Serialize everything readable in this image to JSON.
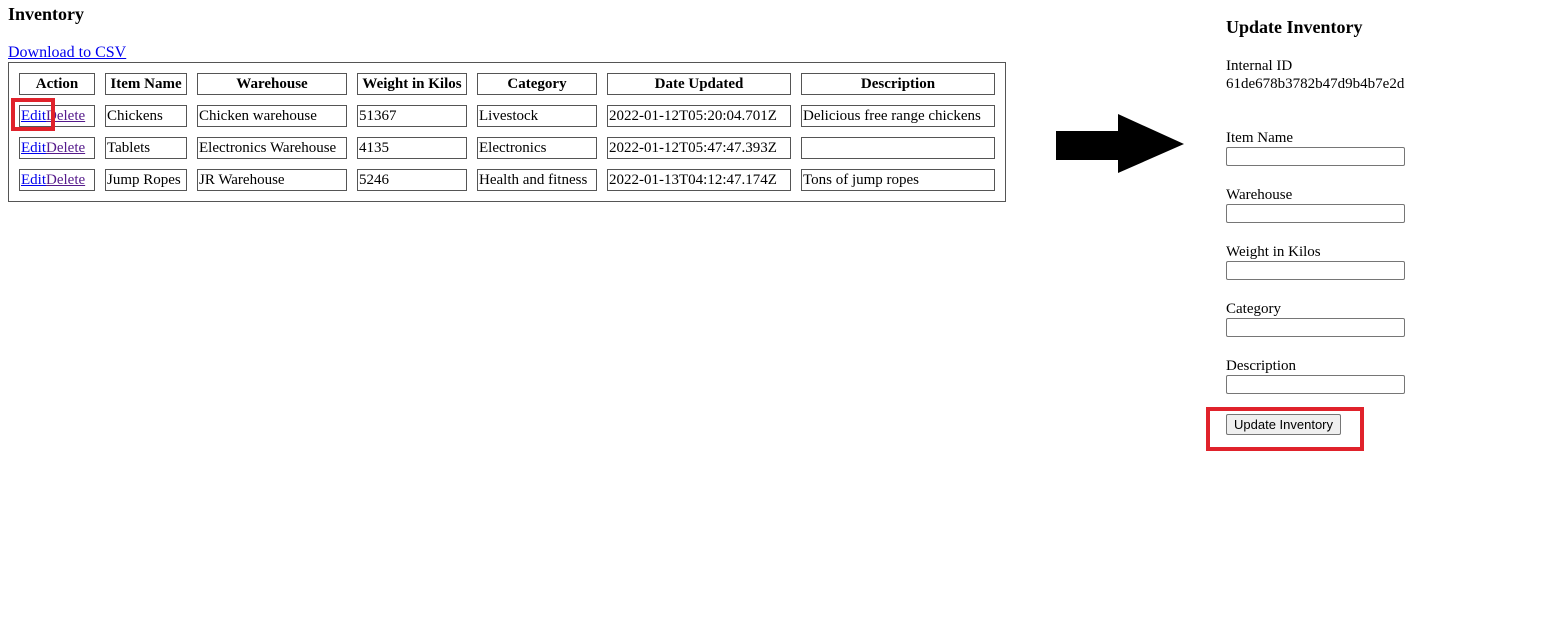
{
  "inventory": {
    "title": "Inventory",
    "download_link": "Download to CSV",
    "columns": [
      "Action",
      "Item Name",
      "Warehouse",
      "Weight in Kilos",
      "Category",
      "Date Updated",
      "Description"
    ],
    "action_labels": {
      "edit": "Edit",
      "delete": "Delete"
    },
    "rows": [
      {
        "item_name": "Chickens",
        "warehouse": "Chicken warehouse",
        "weight": "51367",
        "category": "Livestock",
        "date_updated": "2022-01-12T05:20:04.701Z",
        "description": "Delicious free range chickens"
      },
      {
        "item_name": "Tablets",
        "warehouse": "Electronics Warehouse",
        "weight": "4135",
        "category": "Electronics",
        "date_updated": "2022-01-12T05:47:47.393Z",
        "description": ""
      },
      {
        "item_name": "Jump Ropes",
        "warehouse": "JR Warehouse",
        "weight": "5246",
        "category": "Health and fitness",
        "date_updated": "2022-01-13T04:12:47.174Z",
        "description": "Tons of jump ropes"
      }
    ]
  },
  "update_form": {
    "title": "Update Inventory",
    "internal_id_label": "Internal ID",
    "internal_id_value": "61de678b3782b47d9b4b7e2d",
    "fields": [
      {
        "label": "Item Name",
        "value": ""
      },
      {
        "label": "Warehouse",
        "value": ""
      },
      {
        "label": "Weight in Kilos",
        "value": ""
      },
      {
        "label": "Category",
        "value": ""
      },
      {
        "label": "Description",
        "value": ""
      }
    ],
    "submit_label": "Update Inventory"
  },
  "colors": {
    "link": "#0000ee",
    "visited_link": "#551a8b",
    "highlight": "#e0222b",
    "arrow": "#000000"
  },
  "icons": {
    "arrow": "right-arrow-icon"
  }
}
